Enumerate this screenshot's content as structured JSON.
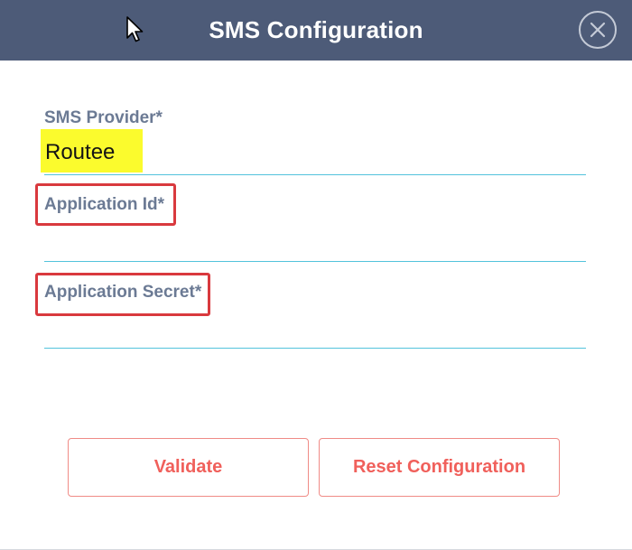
{
  "dialog": {
    "title": "SMS Configuration",
    "close_icon": "close-circle-icon"
  },
  "fields": {
    "provider": {
      "label": "SMS Provider*",
      "value": "Routee"
    },
    "application_id": {
      "label": "Application Id*",
      "value": ""
    },
    "application_secret": {
      "label": "Application Secret*",
      "value": ""
    }
  },
  "buttons": {
    "validate": "Validate",
    "reset": "Reset Configuration"
  },
  "colors": {
    "header": "#4d5b78",
    "accent_line": "#53c3dc",
    "button_text": "#f0605b",
    "annotation_box": "#d9393e",
    "highlight": "#fbfb2d"
  }
}
